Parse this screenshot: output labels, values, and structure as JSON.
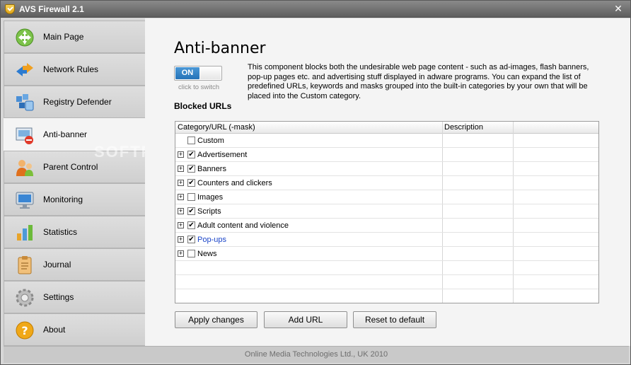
{
  "window": {
    "title": "AVS Firewall 2.1",
    "close_glyph": "✕"
  },
  "sidebar": {
    "items": [
      {
        "label": "Main Page",
        "icon": "main-page-icon",
        "active": false
      },
      {
        "label": "Network Rules",
        "icon": "network-rules-icon",
        "active": false
      },
      {
        "label": "Registry Defender",
        "icon": "registry-defender-icon",
        "active": false
      },
      {
        "label": "Anti-banner",
        "icon": "anti-banner-icon",
        "active": true
      },
      {
        "label": "Parent Control",
        "icon": "parent-control-icon",
        "active": false
      },
      {
        "label": "Monitoring",
        "icon": "monitor-icon",
        "active": false
      },
      {
        "label": "Statistics",
        "icon": "statistics-icon",
        "active": false
      },
      {
        "label": "Journal",
        "icon": "journal-icon",
        "active": false
      },
      {
        "label": "Settings",
        "icon": "gear-icon",
        "active": false
      },
      {
        "label": "About",
        "icon": "help-icon",
        "active": false
      }
    ]
  },
  "watermark": "SOFTPEDIA",
  "main": {
    "heading": "Anti-banner",
    "toggle": {
      "state": "ON",
      "caption": "click to switch"
    },
    "description": "This component blocks both the undesirable web page content - such as ad-images, flash banners, pop-up pages etc. and advertising stuff displayed in adware programs. You can expand the list of predefined URLs, keywords and masks grouped into the built-in categories by your own that will be placed into the Custom category.",
    "section_title": "Blocked URLs",
    "table": {
      "columns": [
        "Category/URL (-mask)",
        "Description"
      ],
      "rows": [
        {
          "label": "Custom",
          "expandable": false,
          "checked": false
        },
        {
          "label": "Advertisement",
          "expandable": true,
          "checked": true
        },
        {
          "label": "Banners",
          "expandable": true,
          "checked": true
        },
        {
          "label": "Counters and clickers",
          "expandable": true,
          "checked": true
        },
        {
          "label": "Images",
          "expandable": true,
          "checked": false
        },
        {
          "label": "Scripts",
          "expandable": true,
          "checked": true
        },
        {
          "label": "Adult content and violence",
          "expandable": true,
          "checked": true
        },
        {
          "label": "Pop-ups",
          "expandable": true,
          "checked": true,
          "link_color": "#1a44c8"
        },
        {
          "label": "News",
          "expandable": true,
          "checked": false
        }
      ]
    },
    "buttons": {
      "apply": "Apply changes",
      "add_url": "Add URL",
      "reset": "Reset to default"
    }
  },
  "footer": {
    "text": "Online Media Technologies Ltd., UK 2010"
  },
  "colors": {
    "toggle_on": "#2f80c4",
    "link": "#1a44c8",
    "active_nav": "#f4f4f4"
  }
}
